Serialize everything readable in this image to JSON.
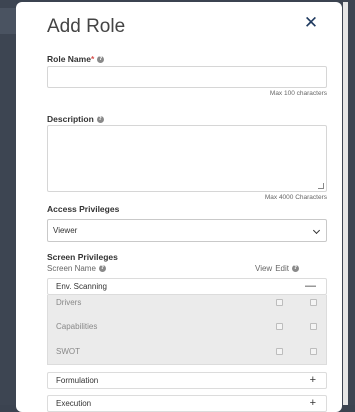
{
  "modal": {
    "title": "Add Role",
    "close_glyph": "✕"
  },
  "role_name": {
    "label": "Role Name",
    "required_mark": "*",
    "value": "",
    "hint": "Max 100 characters"
  },
  "description": {
    "label": "Description",
    "value": "",
    "hint": "Max 4000 Characters"
  },
  "access_privileges": {
    "label": "Access Privileges",
    "selected": "Viewer"
  },
  "screen_privileges": {
    "label": "Screen Privileges",
    "col_screen_name": "Screen Name",
    "col_view": "View",
    "col_edit": "Edit",
    "groups": [
      {
        "name": "Env. Scanning",
        "expanded": true,
        "toggle": "—",
        "screens": [
          {
            "name": "Drivers",
            "view": false,
            "edit": false
          },
          {
            "name": "Capabilities",
            "view": false,
            "edit": false
          },
          {
            "name": "SWOT",
            "view": false,
            "edit": false
          }
        ]
      },
      {
        "name": "Formulation",
        "expanded": false,
        "toggle": "+"
      },
      {
        "name": "Execution",
        "expanded": false,
        "toggle": "+"
      }
    ]
  },
  "help_glyph": "?"
}
